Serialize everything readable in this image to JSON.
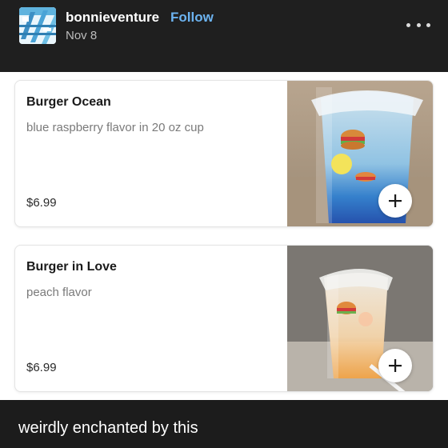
{
  "post": {
    "blog_name": "bonnieventure",
    "follow_label": "Follow",
    "date": "Nov 8",
    "caption": "weirdly enchanted by this"
  },
  "menu_items": [
    {
      "title": "Burger Ocean",
      "description": "blue raspberry flavor in 20 oz cup",
      "price": "$6.99",
      "photo_icon": "blue-drink-photo"
    },
    {
      "title": "Burger in Love",
      "description": "peach flavor",
      "price": "$6.99",
      "photo_icon": "peach-drink-photo"
    }
  ],
  "icons": {
    "more": "more-icon",
    "add": "plus-icon",
    "avatar": "water-slide-avatar"
  },
  "colors": {
    "background": "#1f1f1f",
    "follow_accent": "#6cb3f0",
    "text_primary": "#ffffff",
    "text_secondary": "#bdbdbd"
  }
}
